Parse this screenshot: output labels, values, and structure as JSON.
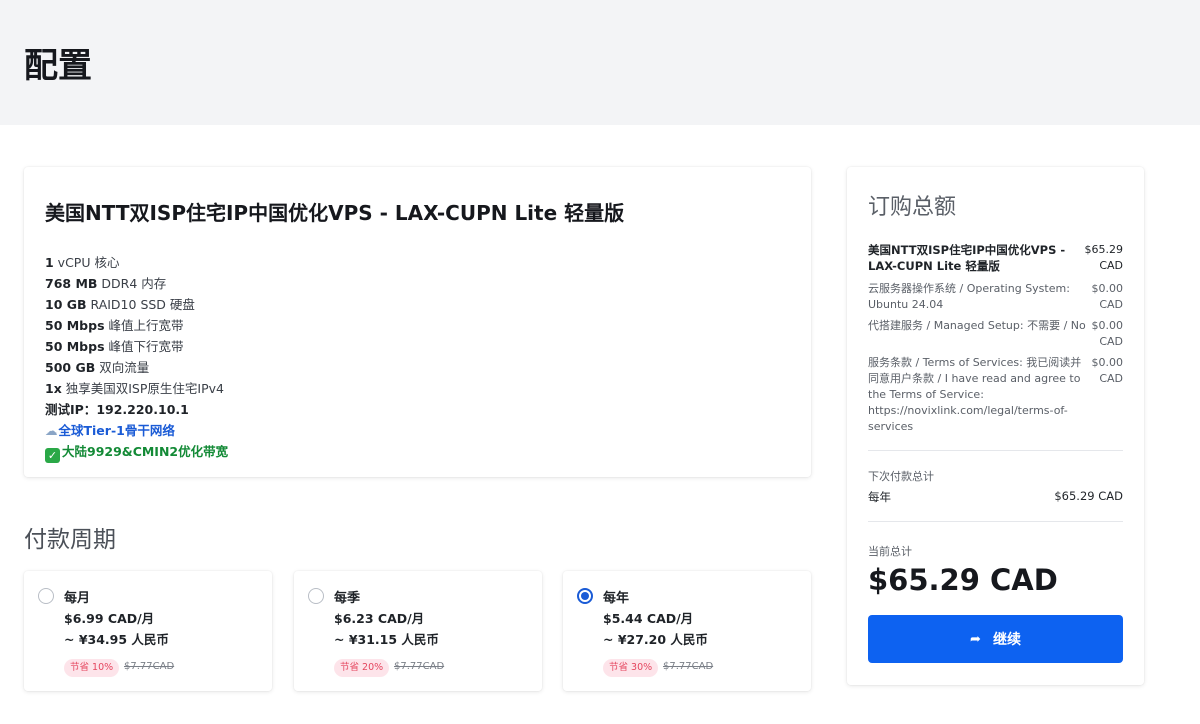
{
  "header": {
    "title": "配置"
  },
  "product": {
    "title": "美国NTT双ISP住宅IP中国优化VPS - LAX-CUPN Lite 轻量版",
    "specs": [
      {
        "bold": "1",
        "text": " vCPU 核心"
      },
      {
        "bold": "768 MB",
        "text": " DDR4 内存"
      },
      {
        "bold": "10 GB",
        "text": " RAID10 SSD 硬盘"
      },
      {
        "bold": "50 Mbps",
        "text": " 峰值上行宽带"
      },
      {
        "bold": "50 Mbps",
        "text": " 峰值下行宽带"
      },
      {
        "bold": "500 GB",
        "text": " 双向流量"
      },
      {
        "bold": "1x",
        "text": " 独享美国双ISP原生住宅IPv4"
      },
      {
        "bold": "测试IP：",
        "text": "192.220.10.1"
      }
    ],
    "feature_tier1": "全球Tier-1骨干网络",
    "feature_cn": "大陆9929&CMIN2优化带宽"
  },
  "billing": {
    "title": "付款周期",
    "options": [
      {
        "name": "每月",
        "price": "$6.99 CAD/月",
        "rmb": "~ ¥34.95 人民币",
        "save": "节省 10%",
        "old_price": "$7.77CAD",
        "selected": false
      },
      {
        "name": "每季",
        "price": "$6.23 CAD/月",
        "rmb": "~ ¥31.15 人民币",
        "save": "节省 20%",
        "old_price": "$7.77CAD",
        "selected": false
      },
      {
        "name": "每年",
        "price": "$5.44 CAD/月",
        "rmb": "~ ¥27.20 人民币",
        "save": "节省 30%",
        "old_price": "$7.77CAD",
        "selected": true
      }
    ]
  },
  "summary": {
    "title": "订购总额",
    "items": [
      {
        "desc": "美国NTT双ISP住宅IP中国优化VPS - LAX-CUPN Lite 轻量版",
        "amount": "$65.29 CAD"
      },
      {
        "desc": "云服务器操作系统 / Operating System: Ubuntu 24.04",
        "amount": "$0.00 CAD"
      },
      {
        "desc": "代搭建服务 / Managed Setup: 不需要 / No",
        "amount": "$0.00 CAD"
      },
      {
        "desc": "服务条款 / Terms of Services: 我已阅读并同意用户条款 / I have read and agree to the Terms of Service: https://novixlink.com/legal/terms-of-services",
        "amount": "$0.00 CAD"
      }
    ],
    "next_label": "下次付款总计",
    "next_period": "每年",
    "next_amount": "$65.29 CAD",
    "current_label": "当前总计",
    "current_total": "$65.29 CAD",
    "continue_label": "继续"
  },
  "colors": {
    "accent": "#0d62f1",
    "save_badge_bg": "#fde4ea",
    "save_badge_text": "#e5465f",
    "tier_blue": "#1a5bd6",
    "cn_green": "#138a36"
  }
}
